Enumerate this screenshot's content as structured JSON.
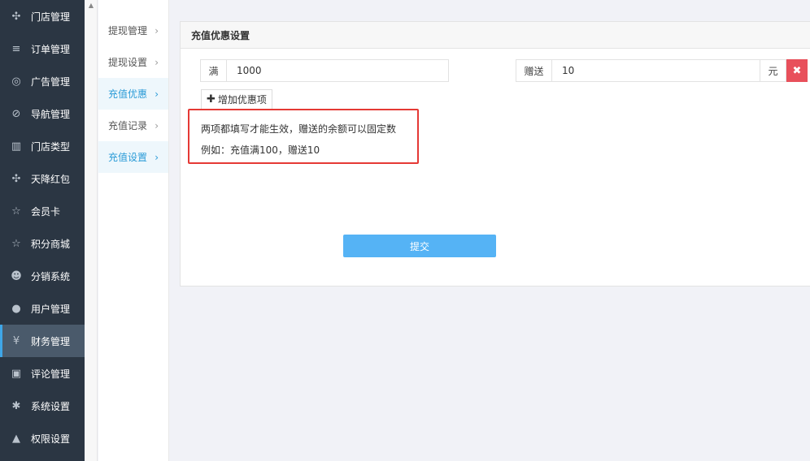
{
  "sidebar": {
    "items": [
      {
        "icon": "cubes-icon",
        "glyph": "✣",
        "label": "门店管理"
      },
      {
        "icon": "list-icon",
        "glyph": "≡",
        "label": "订单管理"
      },
      {
        "icon": "lifebuoy-icon",
        "glyph": "◎",
        "label": "广告管理"
      },
      {
        "icon": "compass-icon",
        "glyph": "⊘",
        "label": "导航管理"
      },
      {
        "icon": "bank-icon",
        "glyph": "▥",
        "label": "门店类型"
      },
      {
        "icon": "cubes-icon",
        "glyph": "✣",
        "label": "天降红包"
      },
      {
        "icon": "star-half-icon",
        "glyph": "☆",
        "label": "会员卡"
      },
      {
        "icon": "star-half-icon",
        "glyph": "☆",
        "label": "积分商城"
      },
      {
        "icon": "users-icon",
        "glyph": "☻",
        "label": "分销系统"
      },
      {
        "icon": "user-icon",
        "glyph": "●",
        "label": "用户管理"
      },
      {
        "icon": "yen-icon",
        "glyph": "¥",
        "label": "财务管理"
      },
      {
        "icon": "money-icon",
        "glyph": "▣",
        "label": "评论管理"
      },
      {
        "icon": "cog-icon",
        "glyph": "✱",
        "label": "系统设置"
      },
      {
        "icon": "lock-icon",
        "glyph": "▲",
        "label": "权限设置"
      }
    ],
    "active_index": 10
  },
  "subnav": {
    "items": [
      {
        "label": "提现管理"
      },
      {
        "label": "提现设置"
      },
      {
        "label": "充值优惠"
      },
      {
        "label": "充值记录"
      },
      {
        "label": "充值设置"
      }
    ],
    "arrow": "›"
  },
  "panel": {
    "title": "充值优惠设置",
    "row": {
      "full_label": "满",
      "full_value": "1000",
      "gift_label": "赠送",
      "gift_value": "10",
      "unit": "元",
      "delete_glyph": "✖"
    },
    "add_button": {
      "plus": "✚",
      "label": "增加优惠项"
    },
    "note": {
      "line1": "两项都填写才能生效，赠送的余额可以固定数",
      "line2": "例如：充值满100，赠送10"
    },
    "submit_label": "提交"
  },
  "colors": {
    "sidebar_bg": "#2b3643",
    "sidebar_active": "#4a5a6b",
    "accent": "#2a9bd7",
    "submit": "#55b3f5",
    "danger": "#e8505b",
    "note_border": "#e53935"
  }
}
